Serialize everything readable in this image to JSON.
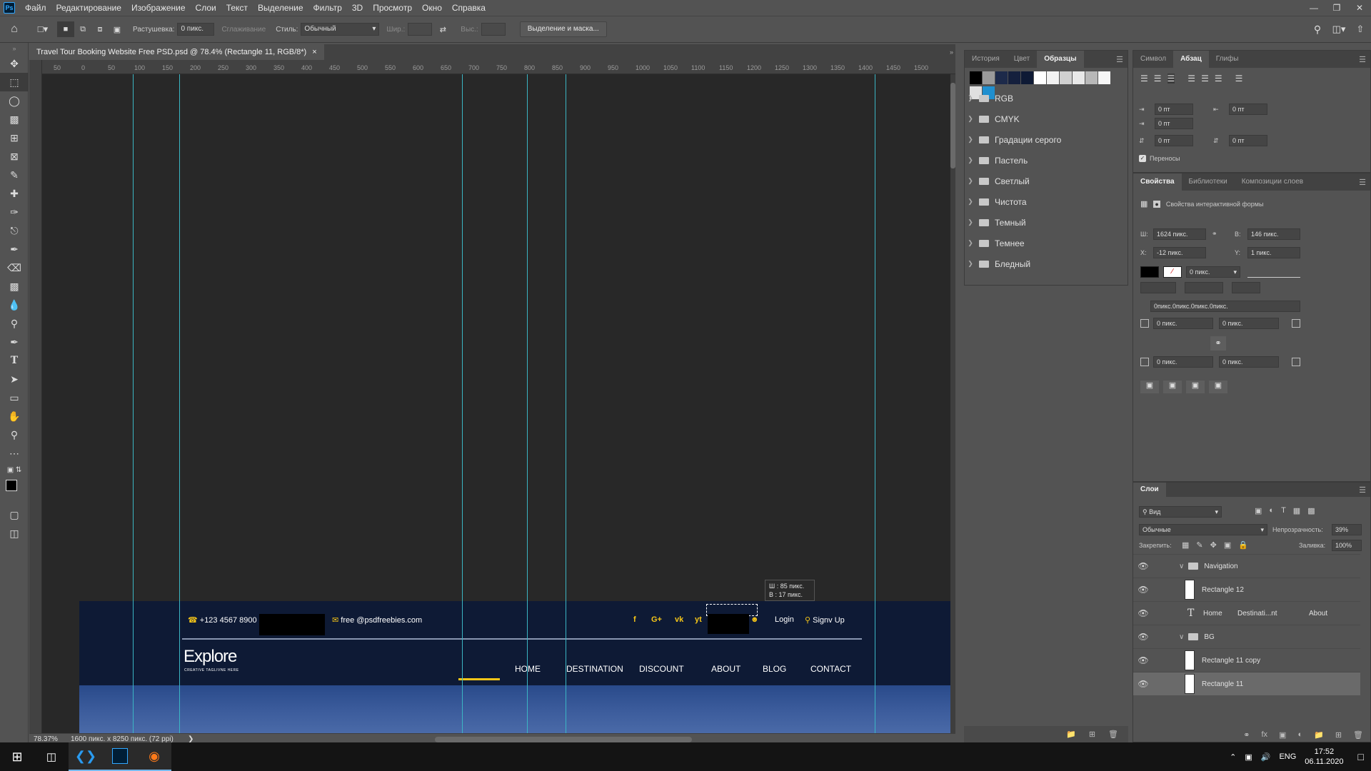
{
  "menubar": {
    "logo": "Ps",
    "items": [
      "Файл",
      "Редактирование",
      "Изображение",
      "Слои",
      "Текст",
      "Выделение",
      "Фильтр",
      "3D",
      "Просмотр",
      "Окно",
      "Справка"
    ]
  },
  "options": {
    "feather_label": "Растушевка:",
    "feather_value": "0 пикс.",
    "antialias_label": "Сглаживание",
    "style_label": "Стиль:",
    "style_value": "Обычный",
    "width_label": "Шир.:",
    "height_label": "Выс.:",
    "select_mask_button": "Выделение и маска..."
  },
  "document": {
    "tab_title": "Travel Tour Booking Website Free PSD.psd @ 78.4% (Rectangle 11, RGB/8*)",
    "close": "×",
    "ruler_ticks": [
      "50",
      "0",
      "50",
      "100",
      "150",
      "200",
      "250",
      "300",
      "350",
      "400",
      "450",
      "500",
      "550",
      "600",
      "650",
      "700",
      "750",
      "800",
      "850",
      "900",
      "950",
      "1000",
      "1050",
      "1100",
      "1150",
      "1200",
      "1250",
      "1300",
      "1350",
      "1400",
      "1450",
      "1500"
    ]
  },
  "site": {
    "phone": "+123 4567 8900",
    "email": "free @psdfreebies.com",
    "login": "Login",
    "signup": "Signv Up",
    "logo_text": "Explore",
    "tagline": "CREATIVE TAGLIVNE HERE",
    "nav": [
      "HOME",
      "DESTINATION",
      "DISCOUNT",
      "ABOUT",
      "BLOG",
      "CONTACT"
    ],
    "social": [
      "f",
      "G+",
      "vk",
      "yt"
    ],
    "tooltip_w": "Ш : 85 пикс.",
    "tooltip_h": "В : 17 пикс."
  },
  "status": {
    "zoom": "78.37%",
    "doc_size": "1600 пикс. x 8250 пикс. (72 ppi)"
  },
  "swatches_panel": {
    "tabs": [
      "История",
      "Цвет",
      "Образцы"
    ],
    "active_tab": "Образцы",
    "colors": [
      "#000000",
      "#9a9a9a",
      "#1d2a4a",
      "#15203d",
      "#0e1a35",
      "#ffffff",
      "#f2f2f2",
      "#d0d0d0",
      "#e8e8e8",
      "#b8b8b8",
      "#f6f6f6",
      "#e0e0e0",
      "#1f8fcf"
    ],
    "groups": [
      "RGB",
      "CMYK",
      "Градации серого",
      "Пастель",
      "Светлый",
      "Чистота",
      "Темный",
      "Темнее",
      "Бледный"
    ]
  },
  "paragraph_panel": {
    "tabs": [
      "Символ",
      "Абзац",
      "Глифы"
    ],
    "active_tab": "Абзац",
    "indent_left": "0 пт",
    "indent_right": "0 пт",
    "indent_first": "0 пт",
    "space_before": "0 пт",
    "space_after": "0 пт",
    "hyphenate": "Переносы"
  },
  "properties_panel": {
    "tabs": [
      "Свойства",
      "Библиотеки",
      "Композиции слоев"
    ],
    "active_tab": "Свойства",
    "section": "Свойства интерактивной формы",
    "w_label": "Ш:",
    "w": "1624 пикс.",
    "h_label": "В:",
    "h": "146 пикс.",
    "x_label": "X:",
    "x": "-12 пикс.",
    "y_label": "Y:",
    "y": "1 пикс.",
    "stroke": "0 пикс.",
    "corners": "0пикс.0пикс.0пикс.0пикс.",
    "c1": "0 пикс.",
    "c2": "0 пикс.",
    "c3": "0 пикс.",
    "c4": "0 пикс."
  },
  "layers_panel": {
    "title": "Слои",
    "filter": "Вид",
    "blend": "Обычные",
    "opacity_label": "Непрозрачность:",
    "opacity": "39%",
    "lock_label": "Закрепить:",
    "fill_label": "Заливка:",
    "fill": "100%",
    "layers": [
      {
        "name": "Navigation",
        "type": "group"
      },
      {
        "name": "Rectangle 12",
        "type": "shape"
      },
      {
        "name": "Home",
        "extra1": "Destinati...nt",
        "extra2": "About",
        "type": "text"
      },
      {
        "name": "BG",
        "type": "group"
      },
      {
        "name": "Rectangle 11 copy",
        "type": "shape"
      },
      {
        "name": "Rectangle 11",
        "type": "shape",
        "selected": true
      }
    ]
  },
  "taskbar": {
    "lang": "ENG",
    "time": "17:52",
    "date": "06.11.2020"
  }
}
